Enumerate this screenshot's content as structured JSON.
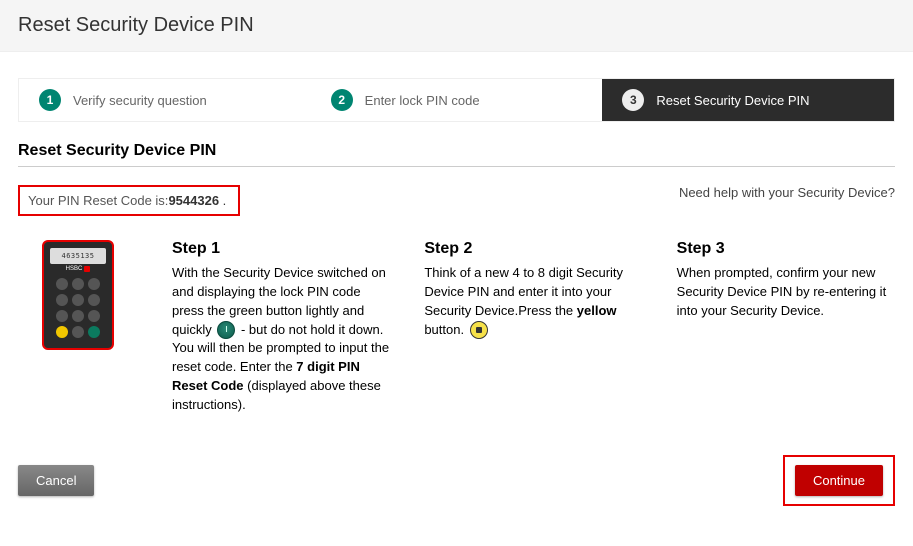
{
  "header": {
    "title": "Reset Security Device PIN"
  },
  "progress": [
    {
      "num": "1",
      "label": "Verify security question",
      "state": "done"
    },
    {
      "num": "2",
      "label": "Enter lock PIN code",
      "state": "done"
    },
    {
      "num": "3",
      "label": "Reset Security Device PIN",
      "state": "active"
    }
  ],
  "section_title": "Reset Security Device PIN",
  "reset_code": {
    "label": "Your PIN Reset Code is:",
    "value": "9544326",
    "suffix": " ."
  },
  "help_link": "Need help with your Security Device?",
  "device": {
    "screen": "4635135",
    "brand": "HSBC"
  },
  "steps": [
    {
      "title": "Step 1",
      "pre": "With the Security Device switched on and displaying the lock PIN code press the green button lightly and quickly ",
      "mid": " - but do not hold it down. You will then be prompted to input the reset code. Enter the ",
      "bold_mid": "7 digit PIN Reset Code",
      "post": " (displayed above  these  instructions)."
    },
    {
      "title": "Step 2",
      "pre": "Think of a new 4 to 8 digit Security Device PIN and enter it into your Security Device.Press the ",
      "bold": "yellow",
      "post": " button. "
    },
    {
      "title": "Step 3",
      "text": "When prompted, confirm your new Security Device PIN by re-entering it into your Security Device."
    }
  ],
  "buttons": {
    "cancel": "Cancel",
    "continue": "Continue"
  }
}
